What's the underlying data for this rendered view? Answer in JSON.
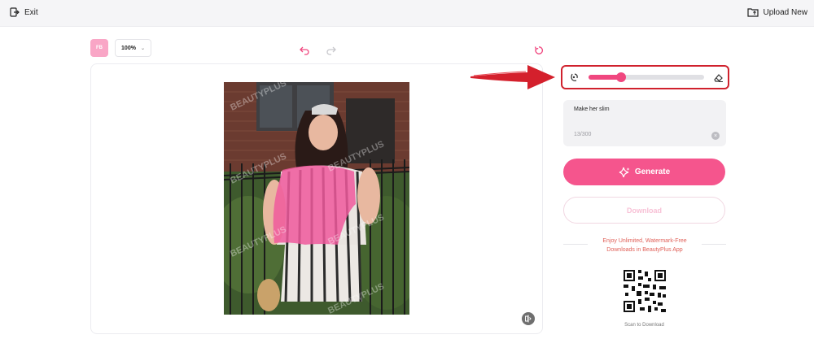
{
  "topbar": {
    "exit_label": "Exit",
    "upload_label": "Upload New"
  },
  "toolbar": {
    "badge": "FB",
    "zoom": "100%"
  },
  "brush_size": {
    "value": 0.28
  },
  "prompt": {
    "text": "Make her slim",
    "count": "13/300"
  },
  "actions": {
    "generate_label": "Generate",
    "download_label": "Download"
  },
  "promo": {
    "line1": "Enjoy Unlimited, Watermark-Free",
    "line2": "Downloads in BeautyPlus App",
    "scan_label": "Scan to Download"
  },
  "photo": {
    "watermark": "BEAUTYPLUS"
  },
  "colors": {
    "accent": "#f5558d",
    "highlight_box": "#d0212d",
    "mask": "#f0599c"
  }
}
